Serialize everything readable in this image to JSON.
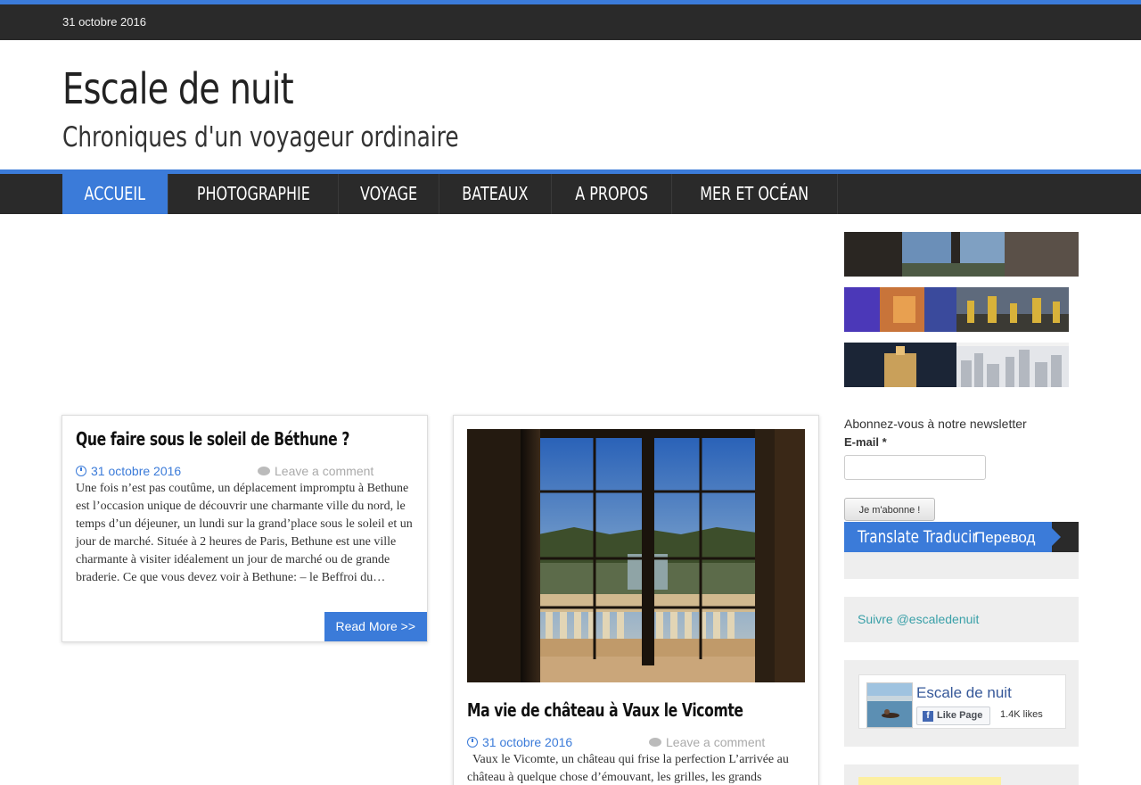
{
  "topbar": {
    "date": "31 octobre 2016"
  },
  "header": {
    "title": "Escale de nuit",
    "tagline": "Chroniques d'un voyageur ordinaire"
  },
  "nav": {
    "items": [
      {
        "label": "ACCUEIL",
        "active": true
      },
      {
        "label": "PHOTOGRAPHIE"
      },
      {
        "label": "VOYAGE"
      },
      {
        "label": "BATEAUX"
      },
      {
        "label": "A PROPOS"
      },
      {
        "label": "MER ET OCÉAN"
      }
    ]
  },
  "posts": [
    {
      "title": "Que faire sous le soleil de Béthune ?",
      "date": "31 octobre 2016",
      "comment_label": "Leave a comment",
      "excerpt": "Une fois n’est pas coutûme, un déplacement impromptu à Bethune est l’occasion unique de découvrir une charmante ville du nord, le temps d’un déjeuner, un lundi sur la grand’place sous le soleil et un jour de marché. Située à 2 heures de Paris, Bethune est une ville charmante à visiter idéalement un jour de marché ou de grande braderie. Ce que vous devez voir à Bethune: – le Beffroi du…",
      "read_more": "Read More >>"
    },
    {
      "title": "Ma vie de château à Vaux le Vicomte",
      "date": "31 octobre 2016",
      "comment_label": "Leave a comment",
      "excerpt": "Vaux le Vicomte, un château qui frise la perfection L’arrivée au château à quelque chose d’émouvant, les grilles, les grands"
    }
  ],
  "sidebar": {
    "newsletter_label": "Abonnez-vous à notre newsletter",
    "email_label": "E-mail",
    "email_required": "*",
    "email_placeholder": "",
    "subscribe_button": "Je m'abonne !",
    "translate_title": "Translate Traducir",
    "translate_russian": "Перевод",
    "follow_link": "Suivre @escaledenuit",
    "fb_page_name": "Escale de nuit",
    "fb_like_button": "Like Page",
    "fb_like_icon": "f",
    "fb_likes_count": "1.4K likes"
  }
}
